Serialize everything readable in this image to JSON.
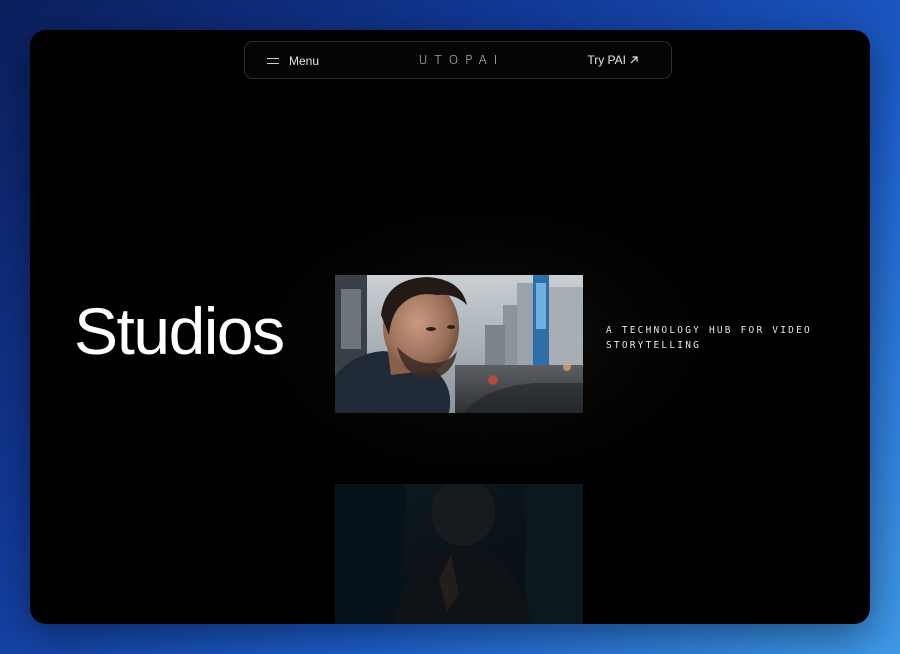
{
  "nav": {
    "menu_label": "Menu",
    "logo_text": "UTOPAI",
    "try_label": "Try PAI"
  },
  "hero": {
    "title": "Studios",
    "tagline": "A TECHNOLOGY HUB FOR VIDEO STORYTELLING"
  },
  "icons": {
    "menu": "hamburger-icon",
    "try": "arrow-up-right-icon"
  },
  "colors": {
    "background": "#000000",
    "text": "#ffffff",
    "outer_gradient_start": "#0b1f5c",
    "outer_gradient_end": "#3f9ae8"
  }
}
